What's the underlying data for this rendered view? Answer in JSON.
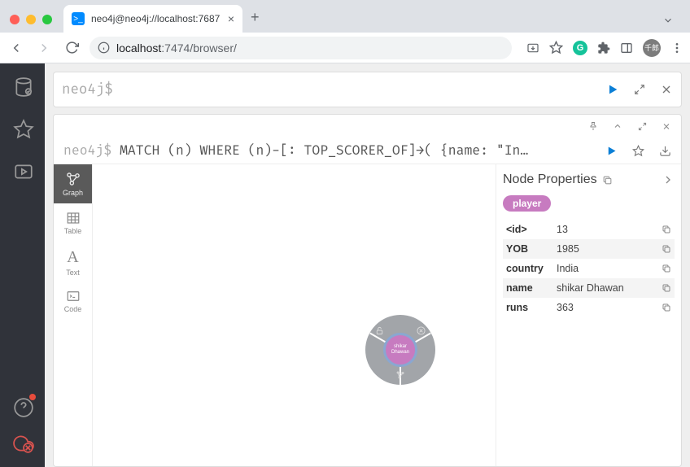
{
  "browser": {
    "tab_title": "neo4j@neo4j://localhost:7687",
    "url_host": "localhost",
    "url_port_path": ":7474/browser/",
    "avatar_label": "千郎"
  },
  "editor": {
    "prompt": "neo4j$"
  },
  "result": {
    "prompt": "neo4j$",
    "query": "MATCH (n) WHERE (n)-[: TOP_SCORER_OF]→( {name: \"In…"
  },
  "views": {
    "graph": "Graph",
    "table": "Table",
    "text": "Text",
    "code": "Code"
  },
  "node": {
    "label": "shikar Dhawan"
  },
  "panel": {
    "title": "Node Properties",
    "badge": "player",
    "rows": [
      {
        "key": "<id>",
        "val": "13"
      },
      {
        "key": "YOB",
        "val": "1985"
      },
      {
        "key": "country",
        "val": "India"
      },
      {
        "key": "name",
        "val": "shikar Dhawan"
      },
      {
        "key": "runs",
        "val": "363"
      }
    ]
  }
}
